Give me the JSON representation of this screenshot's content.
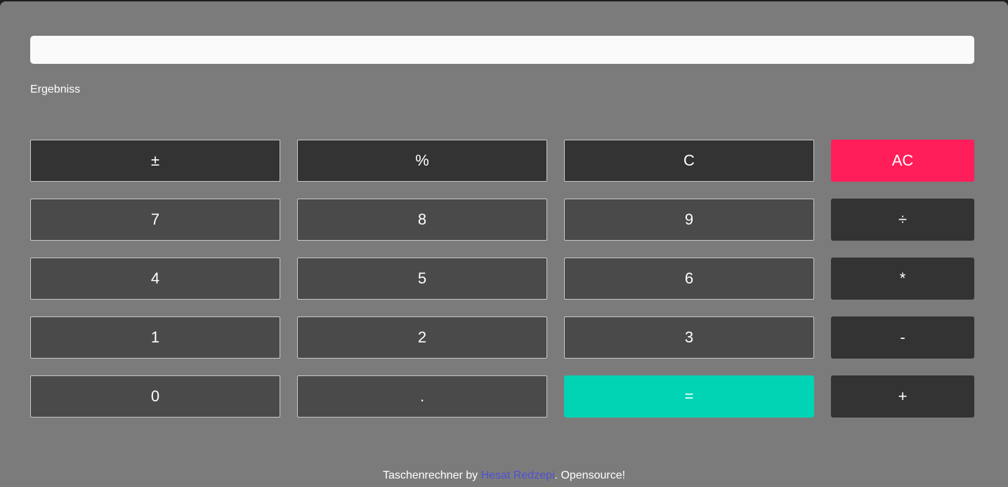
{
  "display": {
    "value": "",
    "placeholder": ""
  },
  "result_label": "Ergebniss",
  "keys": {
    "plus_minus": "±",
    "percent": "%",
    "clear": "C",
    "all_clear": "AC",
    "seven": "7",
    "eight": "8",
    "nine": "9",
    "divide": "÷",
    "four": "4",
    "five": "5",
    "six": "6",
    "multiply": "*",
    "one": "1",
    "two": "2",
    "three": "3",
    "minus": "-",
    "zero": "0",
    "decimal": ".",
    "equals": "=",
    "plus": "+"
  },
  "footer": {
    "prefix": "Taschenrechner by ",
    "author": "Hesat Redzepi",
    "suffix": ". Opensource!"
  },
  "colors": {
    "background": "#7b7b7b",
    "key_dark": "#333333",
    "key_mid": "#4a4a4a",
    "all_clear": "#ff1e5a",
    "equals": "#00d4b4",
    "link": "#4f4fd8"
  }
}
